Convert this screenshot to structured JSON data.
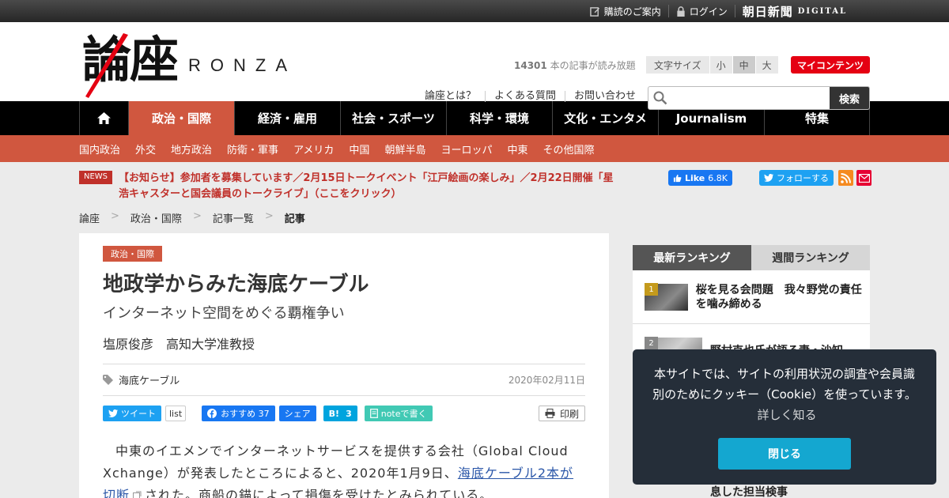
{
  "topbar": {
    "subscribe": "購読のご案内",
    "login": "ログイン",
    "asahi": "朝日新聞",
    "digital": "DIGITAL"
  },
  "header": {
    "logo_kanji": "論座",
    "logo_latin": "RONZA",
    "free_count": "14301",
    "free_text": " 本の記事が読み放題",
    "fontsize_label": "文字サイズ",
    "fontsize_small": "小",
    "fontsize_mid": "中",
    "fontsize_large": "大",
    "my_contents": "マイコンテンツ",
    "links": [
      "論座とは？",
      "よくある質問",
      "お問い合わせ"
    ],
    "search_button": "検索",
    "search_placeholder": ""
  },
  "mainnav": [
    "政治・国際",
    "経済・雇用",
    "社会・スポーツ",
    "科学・環境",
    "文化・エンタメ",
    "Journalism",
    "特集"
  ],
  "subnav": [
    "国内政治",
    "外交",
    "地方政治",
    "防衛・軍事",
    "アメリカ",
    "中国",
    "朝鮮半島",
    "ヨーロッパ",
    "中東",
    "その他国際"
  ],
  "news": {
    "badge": "NEWS",
    "text": "【お知らせ】参加者を募集しています／2月15日トークイベント「江戸絵画の楽しみ」／2月22日開催「星浩キャスターと国会議員のトークライブ」（ここをクリック）"
  },
  "social": {
    "fb_like": "Like",
    "fb_count": "6.8K",
    "twitter_follow": "フォローする"
  },
  "breadcrumb": [
    "論座",
    "政治・国際",
    "記事一覧",
    "記事"
  ],
  "article": {
    "category": "政治・国際",
    "title": "地政学からみた海底ケーブル",
    "subtitle": "インターネット空間をめぐる覇権争い",
    "author": "塩原俊彦　高知大学准教授",
    "tag": "海底ケーブル",
    "date": "2020年02月11日",
    "share": {
      "tweet": "ツイート",
      "list": "list",
      "fb": "おすすめ 37",
      "fb_share": "シェア",
      "hatena_count": "3",
      "note": "noteで書く",
      "print": "印刷"
    },
    "body_1": "中東のイエメンでインターネットサービスを提供する会社（Global Cloud Xchange）が発表したところによると、2020年1月9日、",
    "body_link": "海底ケーブル2本が切断",
    "body_2": "された。商船の錨によって損傷を受けたとみられている。"
  },
  "ranking": {
    "tab_latest": "最新ランキング",
    "tab_weekly": "週間ランキング",
    "items": [
      {
        "num": "1",
        "title": "桜を見る会問題　我々野党の責任を噛み締める"
      },
      {
        "num": "2",
        "title": "野村克也氏が語る妻・沙知"
      }
    ],
    "last_visible": "息した担当検事"
  },
  "cookie": {
    "text": "本サイトでは、サイトの利用状況の調査や会員識別のためにクッキー（Cookie）を使っています。",
    "more": "詳しく知る",
    "close": "閉じる"
  },
  "colors": {
    "accent": "#d0573f",
    "my_contents": "#e50012",
    "news": "#c0302a",
    "cookie_bg": "#252e39",
    "cookie_btn": "#14a7d0"
  }
}
